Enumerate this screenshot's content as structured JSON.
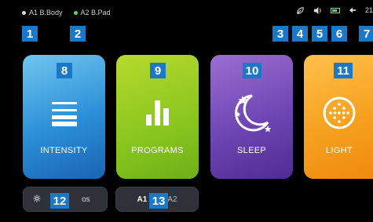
{
  "status_bar": {
    "devices": [
      {
        "label": "A1 B.Body",
        "dot_color": "#dddddd"
      },
      {
        "label": "A2 B.Pad",
        "dot_color": "#5fd35f"
      }
    ],
    "icons": [
      "leaf-icon",
      "volume-icon",
      "battery-icon",
      "bluetooth-icon"
    ],
    "time": "21"
  },
  "markers": [
    "1",
    "2",
    "3",
    "4",
    "5",
    "6",
    "7",
    "8",
    "9",
    "10",
    "11",
    "12",
    "13"
  ],
  "tiles": [
    {
      "label": "INTENSITY",
      "icon": "intensity-lines-icon",
      "color": "#2b8fd8"
    },
    {
      "label": "PROGRAMS",
      "icon": "bar-chart-icon",
      "color": "#88c61e"
    },
    {
      "label": "SLEEP",
      "icon": "moon-stars-icon",
      "color": "#6e45b3"
    },
    {
      "label": "LIGHT",
      "icon": "light-dots-icon",
      "color": "#f6a11f"
    }
  ],
  "bottom": {
    "settings_label": "os",
    "segment": {
      "a1": "A1",
      "a2": "A2",
      "selected": "A1"
    }
  }
}
